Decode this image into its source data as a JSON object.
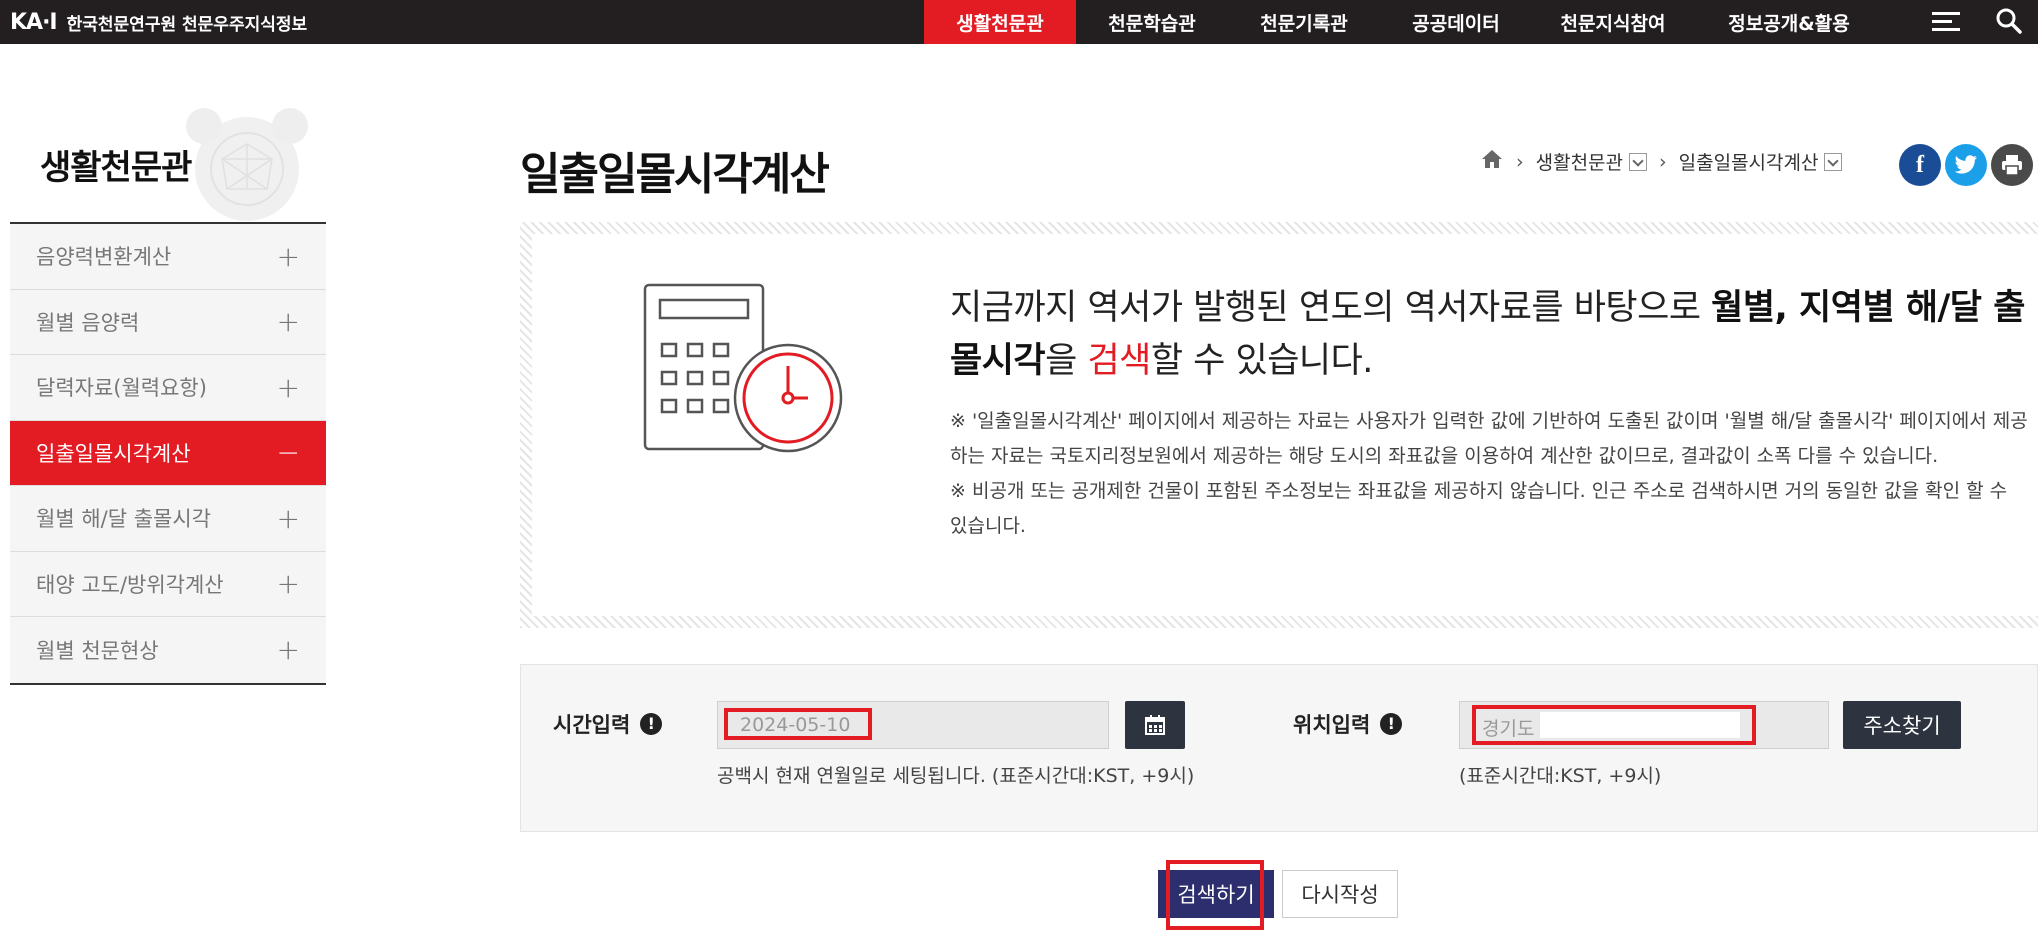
{
  "header": {
    "logo_mark": "KA·I",
    "logo_text": "한국천문연구원 천문우주지식정보",
    "nav": [
      {
        "label": "생활천문관",
        "active": true
      },
      {
        "label": "천문학습관",
        "active": false
      },
      {
        "label": "천문기록관",
        "active": false
      },
      {
        "label": "공공데이터",
        "active": false
      },
      {
        "label": "천문지식참여",
        "active": false
      },
      {
        "label": "정보공개&활용",
        "active": false
      }
    ],
    "menu_icon": "hamburger-menu-icon",
    "search_icon": "search-icon"
  },
  "sidebar": {
    "title": "생활천문관",
    "items": [
      {
        "label": "음양력변환계산",
        "toggle": "+",
        "active": false
      },
      {
        "label": "월별 음양력",
        "toggle": "+",
        "active": false
      },
      {
        "label": "달력자료(월력요항)",
        "toggle": "+",
        "active": false
      },
      {
        "label": "일출일몰시각계산",
        "toggle": "−",
        "active": true
      },
      {
        "label": "월별 해/달 출몰시각",
        "toggle": "+",
        "active": false
      },
      {
        "label": "태양 고도/방위각계산",
        "toggle": "+",
        "active": false
      },
      {
        "label": "월별 천문현상",
        "toggle": "+",
        "active": false
      }
    ]
  },
  "main": {
    "title": "일출일몰시각계산",
    "breadcrumb": {
      "home_icon": "home-icon",
      "level1": "생활천문관",
      "level2": "일출일몰시각계산"
    },
    "share": {
      "facebook": "f",
      "twitter": "t",
      "print_icon": "print-icon"
    },
    "info": {
      "lead_part1": "지금까지 역서가 발행된 연도의 역서자료를 바탕으로 ",
      "lead_bold": "월별, 지역별 해/달 출몰시각",
      "lead_part2": "을 ",
      "lead_red": "검색",
      "lead_part3": "할 수 있습니다.",
      "note1": "※ '일출일몰시각계산' 페이지에서 제공하는 자료는 사용자가 입력한 값에 기반하여 도출된 값이며 '월별 해/달 출몰시각' 페이지에서 제공하는 자료는 국토지리정보원에서 제공하는 해당 도시의 좌표값을 이용하여 계산한 값이므로, 결과값이 소폭 다를 수 있습니다.",
      "note2": "※ 비공개 또는 공개제한 건물이 포함된 주소정보는 좌표값을 제공하지 않습니다. 인근 주소로 검색하시면 거의 동일한 값을 확인 할 수 있습니다."
    },
    "form": {
      "time_label": "시간입력",
      "time_value": "2024-05-10",
      "time_hint": "공백시 현재 연월일로 세팅됩니다. (표준시간대:KST, +9시)",
      "location_label": "위치입력",
      "location_value": "경기도",
      "location_hint": "(표준시간대:KST, +9시)",
      "address_button": "주소찾기",
      "calendar_icon": "calendar-icon"
    },
    "search_button": "검색하기",
    "reset_button": "다시작성"
  },
  "colors": {
    "accent_red": "#e31b23",
    "topbar": "#231f20",
    "search_button": "#2c2e6e",
    "dark_button": "#2d3440"
  }
}
